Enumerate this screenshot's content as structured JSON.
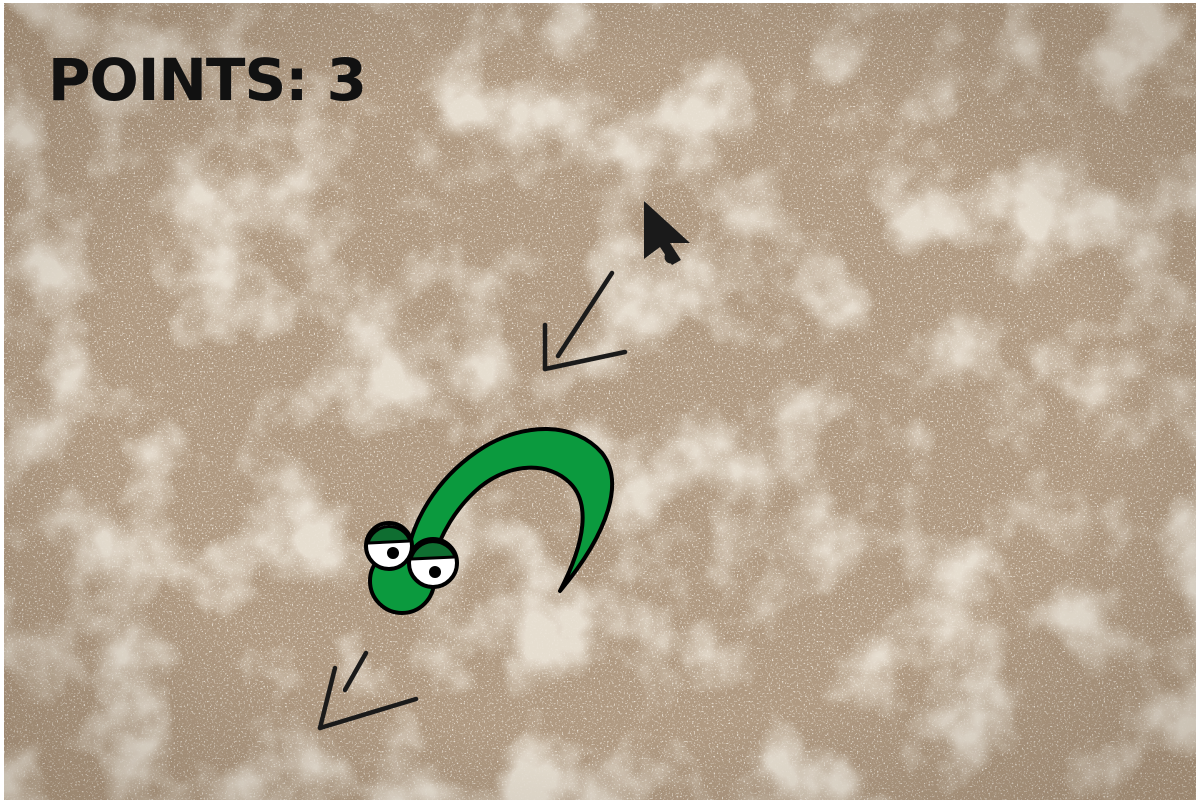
{
  "hud": {
    "score_label": "POINTS: 3"
  },
  "colors": {
    "background": "#b09a82",
    "snake_body": "#0b9a3e",
    "snake_outline": "#000000",
    "eyelid": "#0f6e31",
    "arrow": "#1a1a1a"
  },
  "icons": {
    "cursor": "cursor-icon",
    "trail_arrow": "direction-arrow-icon"
  }
}
